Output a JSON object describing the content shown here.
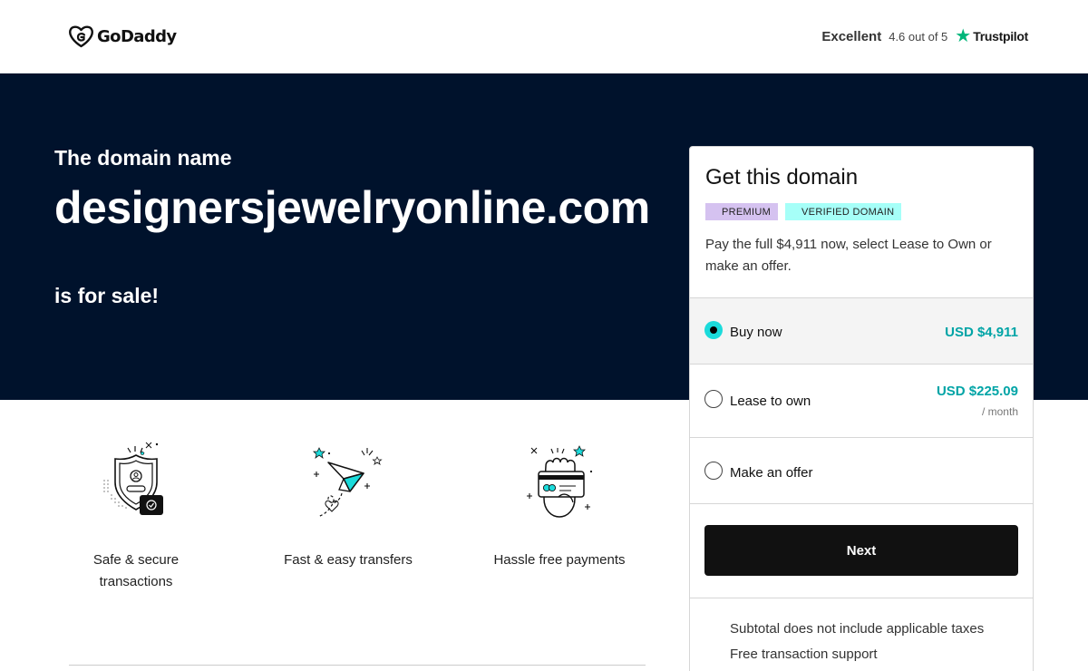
{
  "header": {
    "brand": "GoDaddy",
    "rating": {
      "label": "Excellent",
      "score": "4.6 out of 5",
      "provider": "Trustpilot",
      "star_icon": "star-icon",
      "star_color": "#00b67a"
    }
  },
  "hero": {
    "pre": "The domain name",
    "domain": "designersjewelryonline.com",
    "post": "is for sale!",
    "background": "#00122c"
  },
  "features": [
    {
      "icon": "shield-lock-icon",
      "label": "Safe & secure transactions"
    },
    {
      "icon": "paper-plane-icon",
      "label": "Fast & easy transfers"
    },
    {
      "icon": "hand-card-icon",
      "label": "Hassle free payments"
    }
  ],
  "card": {
    "title": "Get this domain",
    "badges": {
      "premium": "PREMIUM",
      "verified": "VERIFIED DOMAIN"
    },
    "description": "Pay the full $4,911 now, select Lease to Own or make an offer.",
    "options": {
      "buy": {
        "label": "Buy now",
        "price": "USD $4,911",
        "selected": true
      },
      "lease": {
        "label": "Lease to own",
        "price": "USD $225.09",
        "period": "/ month",
        "selected": false
      },
      "offer": {
        "label": "Make an offer",
        "selected": false
      }
    },
    "next_label": "Next",
    "notes": [
      "Subtotal does not include applicable taxes",
      "Free transaction support"
    ],
    "accent_color": "#00a4a6"
  }
}
